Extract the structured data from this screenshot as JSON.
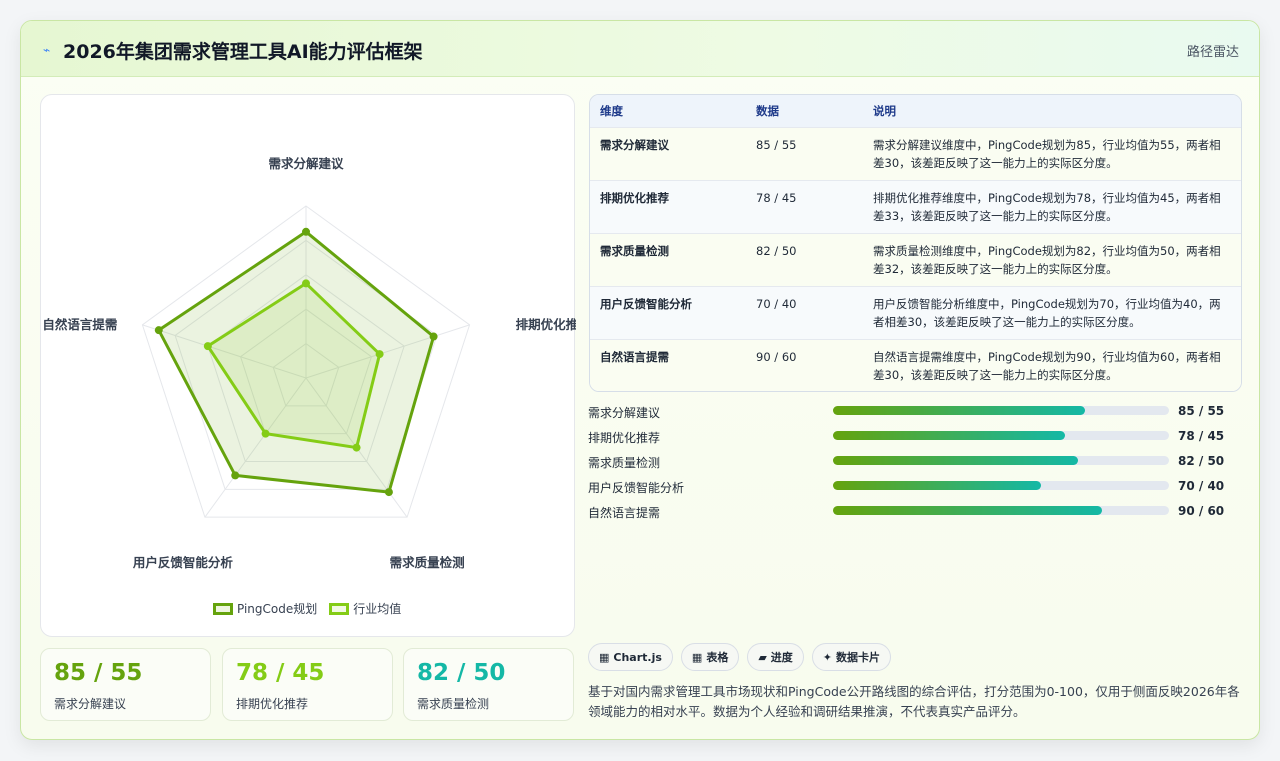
{
  "header": {
    "icon": "line-icon",
    "title": "2026年集团需求管理工具AI能力评估框架",
    "right_link": "路径雷达"
  },
  "colors": {
    "primary": "#65a30d",
    "secondary": "#84cc16",
    "teal": "#14b8a6"
  },
  "chart_data": {
    "type": "radar",
    "categories": [
      "需求分解建议",
      "排期优化推荐",
      "需求质量检测",
      "用户反馈智能分析",
      "自然语言提需"
    ],
    "series": [
      {
        "name": "PingCode规划",
        "values": [
          85,
          78,
          82,
          70,
          90
        ],
        "color": "#65a30d"
      },
      {
        "name": "行业均值",
        "values": [
          55,
          45,
          50,
          40,
          60
        ],
        "color": "#84cc16"
      }
    ],
    "rlim": [
      0,
      100
    ],
    "grid": true,
    "legend": "bottom"
  },
  "stats": [
    {
      "value": "85 / 55",
      "label": "需求分解建议",
      "color": "#65a30d"
    },
    {
      "value": "78 / 45",
      "label": "排期优化推荐",
      "color": "#84cc16"
    },
    {
      "value": "82 / 50",
      "label": "需求质量检测",
      "color": "#14b8a6"
    }
  ],
  "table": {
    "headers": [
      "维度",
      "数据",
      "说明"
    ],
    "rows": [
      [
        "需求分解建议",
        "85 / 55",
        "需求分解建议维度中，PingCode规划为85，行业均值为55，两者相差30，该差距反映了这一能力上的实际区分度。"
      ],
      [
        "排期优化推荐",
        "78 / 45",
        "排期优化推荐维度中，PingCode规划为78，行业均值为45，两者相差33，该差距反映了这一能力上的实际区分度。"
      ],
      [
        "需求质量检测",
        "82 / 50",
        "需求质量检测维度中，PingCode规划为82，行业均值为50，两者相差32，该差距反映了这一能力上的实际区分度。"
      ],
      [
        "用户反馈智能分析",
        "70 / 40",
        "用户反馈智能分析维度中，PingCode规划为70，行业均值为40，两者相差30，该差距反映了这一能力上的实际区分度。"
      ],
      [
        "自然语言提需",
        "90 / 60",
        "自然语言提需维度中，PingCode规划为90，行业均值为60，两者相差30，该差距反映了这一能力上的实际区分度。"
      ]
    ]
  },
  "bars": [
    {
      "label": "需求分解建议",
      "value_text": "85 / 55",
      "progress": 0.75
    },
    {
      "label": "排期优化推荐",
      "value_text": "78 / 45",
      "progress": 0.69
    },
    {
      "label": "需求质量检测",
      "value_text": "82 / 50",
      "progress": 0.73
    },
    {
      "label": "用户反馈智能分析",
      "value_text": "70 / 40",
      "progress": 0.62
    },
    {
      "label": "自然语言提需",
      "value_text": "90 / 60",
      "progress": 0.8
    }
  ],
  "chips": [
    {
      "icon": "grid-icon",
      "glyph": "▦",
      "label": "Chart.js"
    },
    {
      "icon": "table-icon",
      "glyph": "▦",
      "label": "表格"
    },
    {
      "icon": "progress-icon",
      "glyph": "▰",
      "label": "进度"
    },
    {
      "icon": "sparkle-icon",
      "glyph": "✦",
      "label": "数据卡片"
    }
  ],
  "note": "基于对国内需求管理工具市场现状和PingCode公开路线图的综合评估，打分范围为0-100，仅用于侧面反映2026年各领域能力的相对水平。数据为个人经验和调研结果推演，不代表真实产品评分。"
}
